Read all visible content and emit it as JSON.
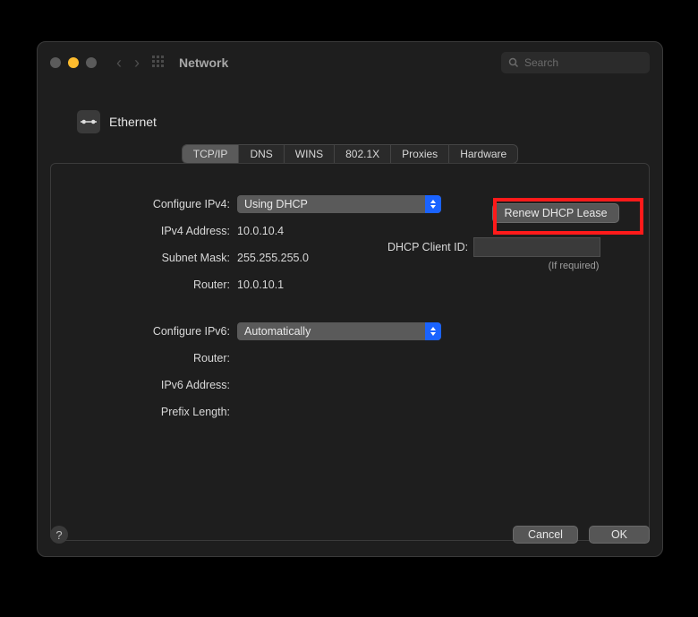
{
  "window": {
    "title": "Network"
  },
  "search": {
    "placeholder": "Search"
  },
  "heading": {
    "interface": "Ethernet"
  },
  "tabs": [
    "TCP/IP",
    "DNS",
    "WINS",
    "802.1X",
    "Proxies",
    "Hardware"
  ],
  "ipv4": {
    "configure_label": "Configure IPv4:",
    "configure_value": "Using DHCP",
    "address_label": "IPv4 Address:",
    "address_value": "10.0.10.4",
    "subnet_label": "Subnet Mask:",
    "subnet_value": "255.255.255.0",
    "router_label": "Router:",
    "router_value": "10.0.10.1"
  },
  "dhcp": {
    "renew_label": "Renew DHCP Lease",
    "client_id_label": "DHCP Client ID:",
    "if_required": "(If required)"
  },
  "ipv6": {
    "configure_label": "Configure IPv6:",
    "configure_value": "Automatically",
    "router_label": "Router:",
    "router_value": "",
    "address_label": "IPv6 Address:",
    "address_value": "",
    "prefix_label": "Prefix Length:",
    "prefix_value": ""
  },
  "buttons": {
    "cancel": "Cancel",
    "ok": "OK"
  }
}
